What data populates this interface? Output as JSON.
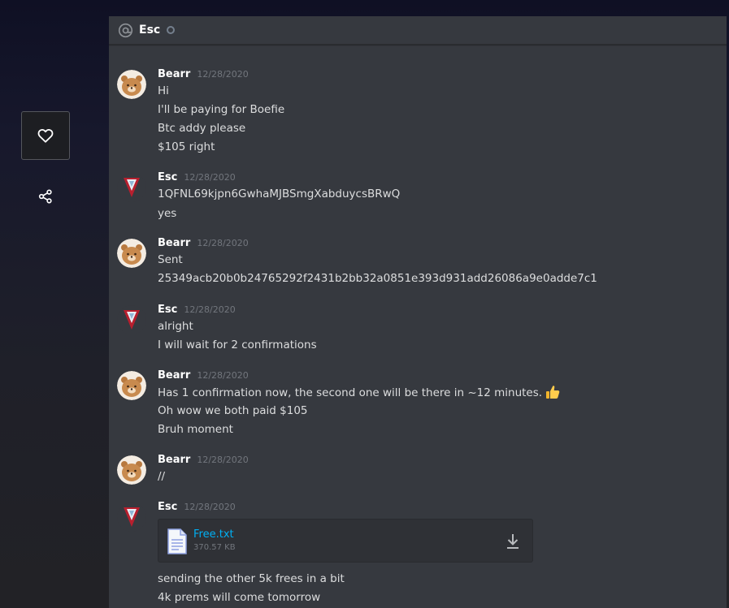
{
  "side": {
    "like_icon": "heart-icon",
    "share_icon": "share-icon"
  },
  "header": {
    "icon": "at-icon",
    "name": "Esc",
    "status": "offline"
  },
  "messages": [
    {
      "author": "Bearr",
      "avatar": "bear-avatar",
      "timestamp": "12/28/2020",
      "lines": [
        "Hi",
        "I'll be paying for Boefie",
        "Btc addy please",
        "$105 right"
      ]
    },
    {
      "author": "Esc",
      "avatar": "esc-avatar",
      "timestamp": "12/28/2020",
      "lines": [
        "1QFNL69kjpn6GwhaMJBSmgXabduycsBRwQ",
        "yes"
      ]
    },
    {
      "author": "Bearr",
      "avatar": "bear-avatar",
      "timestamp": "12/28/2020",
      "lines": [
        "Sent",
        "25349acb20b0b24765292f2431b2bb32a0851e393d931add26086a9e0adde7c1"
      ]
    },
    {
      "author": "Esc",
      "avatar": "esc-avatar",
      "timestamp": "12/28/2020",
      "lines": [
        "alright",
        "I will wait for 2 confirmations"
      ]
    },
    {
      "author": "Bearr",
      "avatar": "bear-avatar",
      "timestamp": "12/28/2020",
      "lines": [
        "Has 1 confirmation now, the second one will be there in ~12 minutes.",
        "Oh wow we both paid $105",
        "Bruh moment"
      ],
      "emoji": "thumbs-up-icon"
    },
    {
      "author": "Bearr",
      "avatar": "bear-avatar",
      "timestamp": "12/28/2020",
      "lines": [
        "//"
      ]
    },
    {
      "author": "Esc",
      "avatar": "esc-avatar",
      "timestamp": "12/28/2020",
      "attachment": {
        "name": "Free.txt",
        "size": "370.57 KB",
        "icon": "file-icon",
        "action_icon": "download-icon"
      },
      "lines": [
        "sending the other 5k frees in a bit",
        "4k prems will come tomorrow"
      ]
    }
  ]
}
